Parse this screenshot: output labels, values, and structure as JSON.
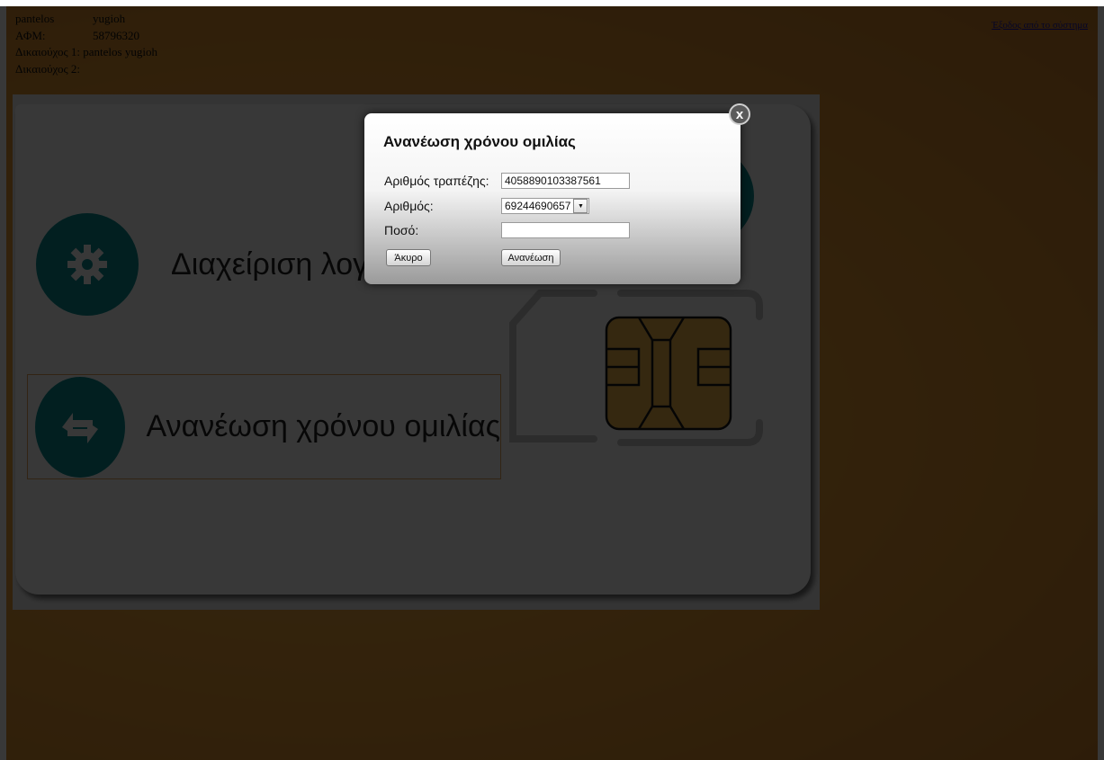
{
  "user": {
    "name_label": "pantelos",
    "name_value": "yugioh",
    "afm_label": "ΑΦΜ:",
    "afm_value": "58796320",
    "holder1": "Δικαιούχος 1: pantelos yugioh",
    "holder2": "Δικαιούχος 2:"
  },
  "logout_label": "Έξοδος από το σύστημα",
  "menu": {
    "item1_label": "Διαχείριση λογ",
    "item2_label": "Ανανέωση χρόνου ομιλίας"
  },
  "modal": {
    "title": "Ανανέωση χρόνου ομιλίας",
    "close_label": "x",
    "card_label": "Αριθμός τραπέζης:",
    "card_value": "4058890103387561",
    "number_label": "Αριθμός:",
    "number_value": "69244690657",
    "amount_label": "Ποσό:",
    "amount_value": "",
    "cancel_label": "Άκυρο",
    "renew_label": "Ανανέωση"
  },
  "colors": {
    "accent": "#0b8f94",
    "backdrop": "#e59a35"
  },
  "icons": {
    "item1": "gear-icon",
    "item2": "refresh-icon"
  }
}
